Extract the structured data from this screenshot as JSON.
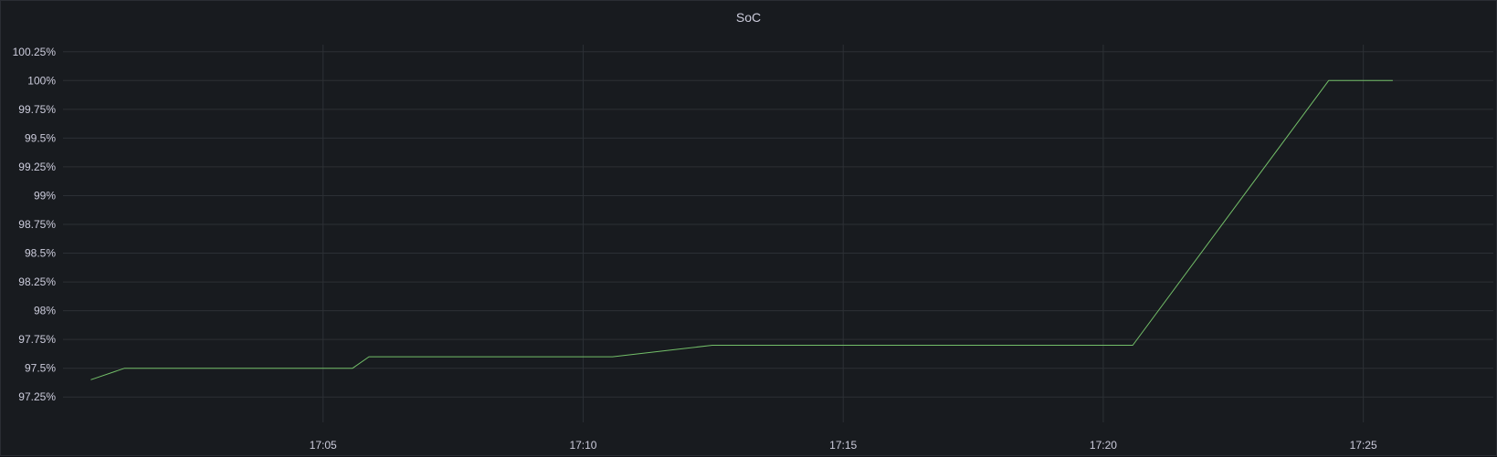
{
  "panel": {
    "title": "SoC"
  },
  "chart_data": {
    "type": "line",
    "title": "SoC",
    "xlabel": "",
    "ylabel": "",
    "x_ticks": [
      "17:05",
      "17:10",
      "17:15",
      "17:20",
      "17:25"
    ],
    "y_ticks": [
      "97.25%",
      "97.5%",
      "97.75%",
      "98%",
      "98.25%",
      "98.5%",
      "98.75%",
      "99%",
      "99.25%",
      "99.5%",
      "99.75%",
      "100%",
      "100.25%"
    ],
    "xlim": [
      "17:00:00",
      "17:27:30"
    ],
    "ylim": [
      97.125,
      100.375
    ],
    "grid": true,
    "legend": "none",
    "colors": {
      "background": "#181b1f",
      "grid": "#2c3035",
      "series": "#73bf69",
      "text": "#ccccdc"
    },
    "series": [
      {
        "x": [
          "17:00:32",
          "17:01:11",
          "17:05:34",
          "17:05:53",
          "17:10:34",
          "17:12:29",
          "17:20:34",
          "17:24:20",
          "17:25:34"
        ],
        "values": [
          97.4,
          97.5,
          97.5,
          97.6,
          97.6,
          97.7,
          97.7,
          100.0,
          100.0
        ]
      }
    ]
  }
}
